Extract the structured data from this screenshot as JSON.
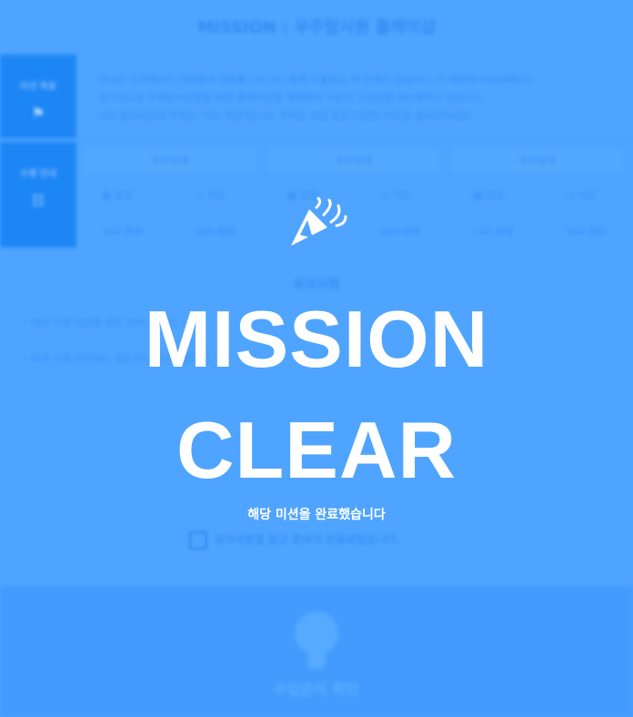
{
  "background": {
    "title": "MISSION : 우주탐사원 플레이샵",
    "rows": [
      {
        "label": "미션 목표",
        "icon": "flag-icon"
      },
      {
        "label": "수행 안내",
        "icon": "list-icon"
      }
    ],
    "description": [
      "머나먼 우주에서는 사람들과 대화를 나누거나 함께 어울리는 데 한계가 있습니다. 이 때문에 KASA에서는",
      "정기적으로 우주탐사원들을 위한 플레이샵을 개최하여 서로의 고립감을 해소해주고 있습니다.",
      "이번 플레이샵의 주제는 '색소 재생'입니다. 주어진 시간 동안 다양한 카드를 플레이하세요."
    ],
    "column_header": "우리집에",
    "cells": {
      "date": "일정",
      "time": "시간",
      "amount": "100 분량"
    },
    "notice_title": "유의사항",
    "notes": [
      "미션 수행 시간을 모두 지켜 주세요.",
      "미션 수행 이후에는 재도전이 불가능합니다."
    ],
    "footer_label": "수업준비 확인"
  },
  "overlay": {
    "title_line1": "MISSION",
    "title_line2": "CLEAR",
    "subtitle": "해당 미션을 완료했습니다",
    "checkbox_label": "유의사항을 읽고 준비가 완료되었습니다.",
    "icon": "party-popper-icon"
  }
}
